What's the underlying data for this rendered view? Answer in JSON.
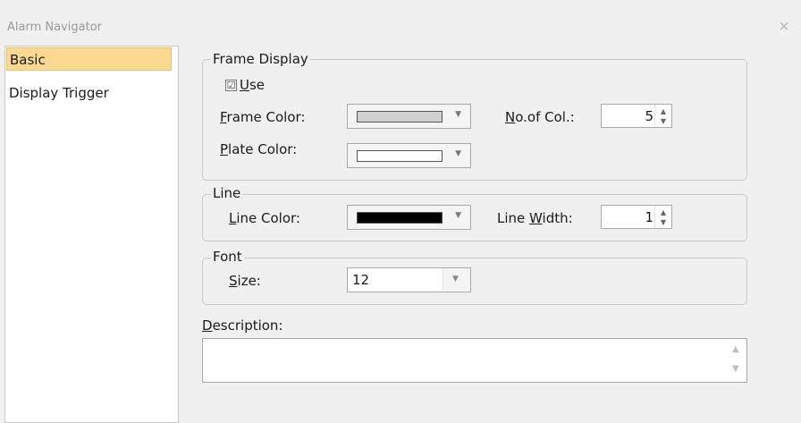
{
  "window": {
    "title": "Alarm Navigator",
    "close_glyph": "×"
  },
  "nav": {
    "items": [
      {
        "label": "Basic"
      },
      {
        "label": "Display Trigger"
      }
    ]
  },
  "frame_display": {
    "legend": "Frame Display",
    "use_checked": true,
    "use_label_key": "U",
    "use_label_rest": "se",
    "frame_color_key": "F",
    "frame_color_rest": "rame Color:",
    "frame_color_value": "#d0d0d0",
    "plate_color_key": "P",
    "plate_color_rest": "late Color:",
    "plate_color_value": "#ffffff",
    "cols_key": "N",
    "cols_rest": "o.of Col.:",
    "cols_value": "5"
  },
  "line": {
    "legend": "Line",
    "color_key": "L",
    "color_rest": "ine Color:",
    "color_value": "#000000",
    "width_prefix": "Line ",
    "width_key": "W",
    "width_rest": "idth:",
    "width_value": "1"
  },
  "font": {
    "legend": "Font",
    "size_key": "S",
    "size_rest": "ize:",
    "size_value": "12"
  },
  "description": {
    "label_key": "D",
    "label_rest": "escription:",
    "value": ""
  },
  "icons": {
    "dropdown": "▼",
    "spin_up": "▲",
    "spin_down": "▼",
    "check": "☑"
  }
}
